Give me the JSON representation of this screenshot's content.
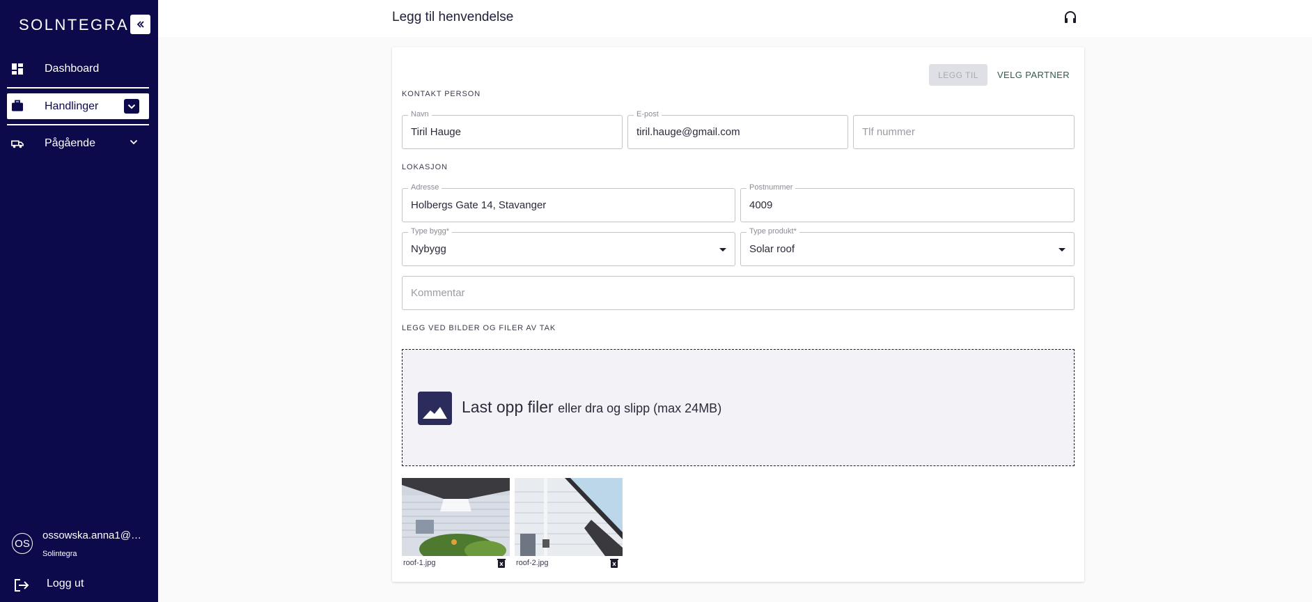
{
  "sidebar": {
    "logo": "SOLNTEGRA",
    "nav": {
      "dashboard": "Dashboard",
      "handlinger": "Handlinger",
      "pagaende": "Pågående"
    },
    "user": {
      "initials": "OS",
      "email": "ossowska.anna1@gmail.com",
      "org": "Solintegra"
    },
    "logout": "Logg ut"
  },
  "header": {
    "title": "Legg til henvendelse"
  },
  "form": {
    "buttons": {
      "add": "LEGG TIL",
      "partner": "VELG PARTNER"
    },
    "contact": {
      "section_label": "KONTAKT PERSON",
      "name_label": "Navn",
      "name_value": "Tiril Hauge",
      "email_label": "E-post",
      "email_value": "tiril.hauge@gmail.com",
      "phone_placeholder": "Tlf nummer"
    },
    "location": {
      "section_label": "LOKASJON",
      "address_label": "Adresse",
      "address_value": "Holbergs Gate 14, Stavanger",
      "postal_label": "Postnummer",
      "postal_value": "4009",
      "building_label": "Type bygg*",
      "building_value": "Nybygg",
      "product_label": "Type produkt*",
      "product_value": "Solar roof",
      "comment_placeholder": "Kommentar"
    },
    "upload": {
      "section_label": "LEGG VED BILDER OG FILER AV TAK",
      "main": "Last opp filer",
      "sub": "eller dra og slipp (max 24MB)",
      "files": [
        {
          "name": "roof-1.jpg"
        },
        {
          "name": "roof-2.jpg"
        }
      ]
    }
  },
  "colors": {
    "sidebar_bg": "#0c0a4a",
    "accent_green": "#2e5b4f",
    "disabled_btn": "#dfdfe6"
  }
}
